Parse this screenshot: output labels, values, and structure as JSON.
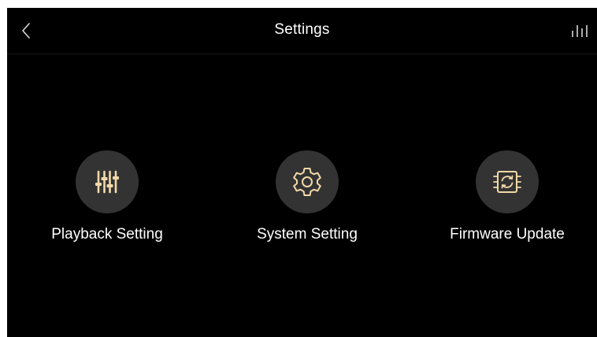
{
  "header": {
    "title": "Settings",
    "back_icon": "chevron-left-icon",
    "right_icon": "equalizer-bars-icon"
  },
  "menu": {
    "items": [
      {
        "label": "Playback Setting",
        "icon": "sliders-icon"
      },
      {
        "label": "System Setting",
        "icon": "gear-icon"
      },
      {
        "label": "Firmware Update",
        "icon": "chip-refresh-icon"
      }
    ]
  },
  "colors": {
    "background": "#000000",
    "icon_circle": "#333333",
    "icon_accent": "#f2d9a8",
    "text": "#ffffff"
  }
}
